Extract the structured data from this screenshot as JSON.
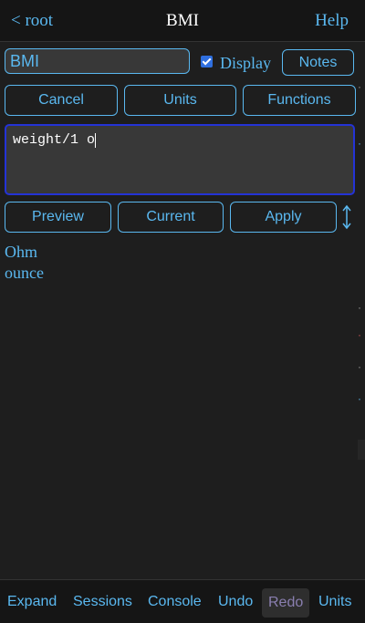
{
  "header": {
    "back_label": "< root",
    "title": "BMI",
    "help_label": "Help"
  },
  "form": {
    "name_value": "BMI",
    "display_checked": true,
    "display_label": "Display",
    "notes_label": "Notes"
  },
  "toolbar": {
    "cancel_label": "Cancel",
    "units_label": "Units",
    "functions_label": "Functions"
  },
  "editor": {
    "expression": "weight/1 o"
  },
  "actions": {
    "preview_label": "Preview",
    "current_label": "Current",
    "apply_label": "Apply",
    "resize_icon": "vertical-resize-arrow-icon"
  },
  "suggestions": [
    "Ohm",
    "ounce"
  ],
  "footer": {
    "items": [
      {
        "label": "Expand",
        "enabled": true
      },
      {
        "label": "Sessions",
        "enabled": true
      },
      {
        "label": "Console",
        "enabled": true
      },
      {
        "label": "Undo",
        "enabled": true
      },
      {
        "label": "Redo",
        "enabled": false
      },
      {
        "label": "Units",
        "enabled": true
      }
    ]
  },
  "colors": {
    "background": "#1e1e1e",
    "bar_background": "#151515",
    "accent": "#5ab8f0",
    "title_text": "#ffffff",
    "field_background": "#383838",
    "editor_focus_border": "#2433d6",
    "checkbox": "#2f6fdf",
    "disabled_text": "#8a7fb0"
  }
}
